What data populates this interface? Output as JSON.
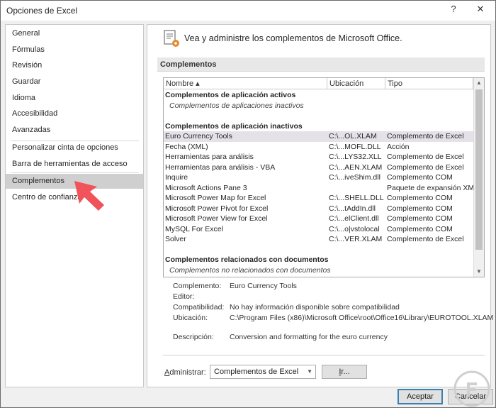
{
  "window": {
    "title": "Opciones de Excel",
    "help_glyph": "?",
    "close_glyph": "✕"
  },
  "sidebar": {
    "items": [
      {
        "label": "General"
      },
      {
        "label": "Fórmulas"
      },
      {
        "label": "Revisión"
      },
      {
        "label": "Guardar"
      },
      {
        "label": "Idioma"
      },
      {
        "label": "Accesibilidad"
      },
      {
        "label": "Avanzadas"
      },
      {
        "label": "Personalizar cinta de opciones"
      },
      {
        "label": "Barra de herramientas de acceso rápido"
      },
      {
        "label": "Complementos",
        "selected": true
      },
      {
        "label": "Centro de confianza"
      }
    ]
  },
  "main": {
    "header": "Vea y administre los complementos de Microsoft Office.",
    "section_title": "Complementos",
    "columns": {
      "name": "Nombre ▴",
      "location": "Ubicación",
      "type": "Tipo"
    },
    "rows": [
      {
        "kind": "group",
        "name": "Complementos de aplicación activos"
      },
      {
        "kind": "empty",
        "name": "Complementos de aplicaciones inactivos"
      },
      {
        "kind": "blank"
      },
      {
        "kind": "group",
        "name": "Complementos de aplicación inactivos"
      },
      {
        "kind": "item",
        "name": "Euro Currency Tools",
        "location": "C:\\...OL.XLAM",
        "type": "Complemento de Excel",
        "highlight": true
      },
      {
        "kind": "item",
        "name": "Fecha (XML)",
        "location": "C:\\...MOFL.DLL",
        "type": "Acción"
      },
      {
        "kind": "item",
        "name": "Herramientas para análisis",
        "location": "C:\\...LYS32.XLL",
        "type": "Complemento de Excel"
      },
      {
        "kind": "item",
        "name": "Herramientas para análisis - VBA",
        "location": "C:\\...AEN.XLAM",
        "type": "Complemento de Excel"
      },
      {
        "kind": "item",
        "name": "Inquire",
        "location": "C:\\...iveShim.dll",
        "type": "Complemento COM"
      },
      {
        "kind": "item",
        "name": "Microsoft Actions Pane 3",
        "location": "",
        "type": "Paquete de expansión XML"
      },
      {
        "kind": "item",
        "name": "Microsoft Power Map for Excel",
        "location": "C:\\...SHELL.DLL",
        "type": "Complemento COM"
      },
      {
        "kind": "item",
        "name": "Microsoft Power Pivot for Excel",
        "location": "C:\\...tAddIn.dll",
        "type": "Complemento COM"
      },
      {
        "kind": "item",
        "name": "Microsoft Power View for Excel",
        "location": "C:\\...elClient.dll",
        "type": "Complemento COM"
      },
      {
        "kind": "item",
        "name": "MySQL For Excel",
        "location": "C:\\...o|vstolocal",
        "type": "Complemento COM"
      },
      {
        "kind": "item",
        "name": "Solver",
        "location": "C:\\...VER.XLAM",
        "type": "Complemento de Excel"
      },
      {
        "kind": "blank"
      },
      {
        "kind": "group",
        "name": "Complementos relacionados con documentos"
      },
      {
        "kind": "empty",
        "name": "Complementos no relacionados con documentos"
      }
    ],
    "details": {
      "complemento_label": "Complemento:",
      "complemento_value": "Euro Currency Tools",
      "editor_label": "Editor:",
      "editor_value": "",
      "compat_label": "Compatibilidad:",
      "compat_value": "No hay información disponible sobre compatibilidad",
      "ubicacion_label": "Ubicación:",
      "ubicacion_value": "C:\\Program Files (x86)\\Microsoft Office\\root\\Office16\\Library\\EUROTOOL.XLAM",
      "descripcion_label": "Descripción:",
      "descripcion_value": "Conversion and formatting for the euro currency"
    },
    "manage": {
      "label_prefix": "A",
      "label_rest": "dministrar:",
      "selected": "Complementos de Excel",
      "go_prefix": "I",
      "go_rest": "r..."
    }
  },
  "buttons": {
    "ok": "Aceptar",
    "cancel": "Cancelar"
  },
  "colors": {
    "selected_sidebar": "#cfcfcf",
    "highlight_row": "#e4e2e8",
    "arrow_pointer": "#f0535a",
    "primary_border": "#3c7fb1"
  }
}
